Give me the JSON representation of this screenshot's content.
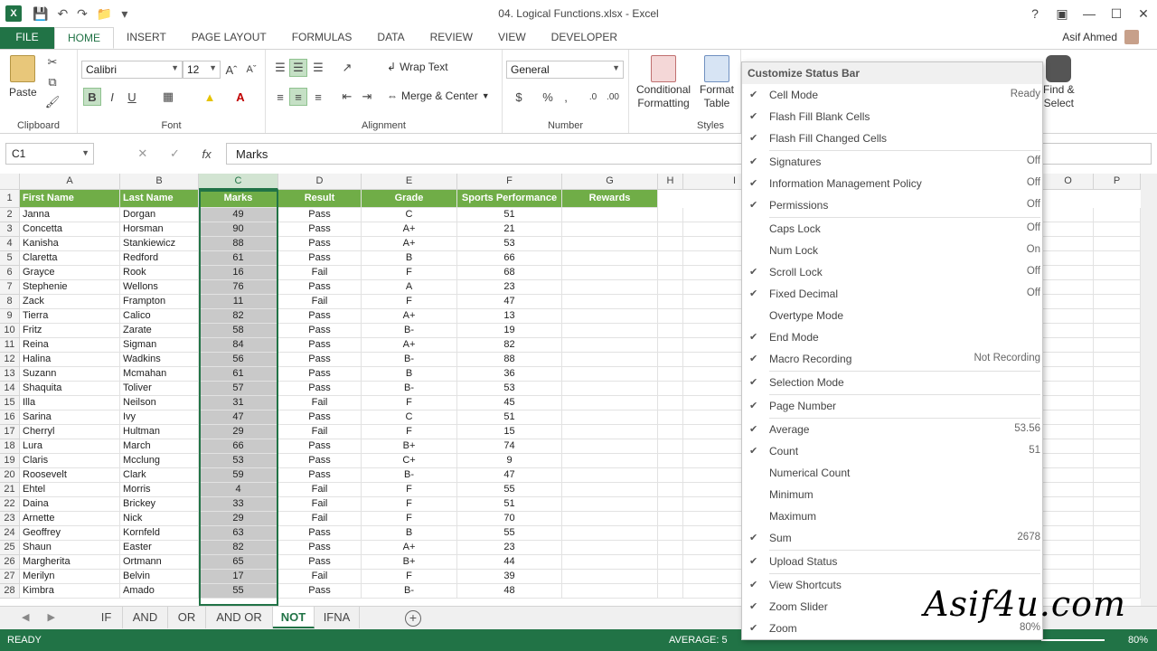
{
  "window": {
    "title": "04. Logical Functions.xlsx - Excel",
    "user_name": "Asif Ahmed"
  },
  "ribbon_tabs": [
    "FILE",
    "HOME",
    "INSERT",
    "PAGE LAYOUT",
    "FORMULAS",
    "DATA",
    "REVIEW",
    "VIEW",
    "DEVELOPER"
  ],
  "ribbon": {
    "clipboard": {
      "paste_label": "Paste",
      "group_label": "Clipboard"
    },
    "font": {
      "font_name": "Calibri",
      "font_size": "12",
      "group_label": "Font",
      "bold": "B",
      "italic": "I",
      "underline": "U"
    },
    "alignment": {
      "wrap_text": "Wrap Text",
      "merge_center": "Merge & Center",
      "group_label": "Alignment"
    },
    "number": {
      "format": "General",
      "group_label": "Number",
      "currency": "$",
      "percent": "%",
      "comma": ","
    },
    "styles": {
      "conditional_formatting_1": "Conditional",
      "conditional_formatting_2": "Formatting",
      "format_table_1": "Format",
      "format_table_2": "Table",
      "group_label": "Styles"
    },
    "editing": {
      "find_select_1": "Find &",
      "find_select_2": "Select"
    }
  },
  "formula_bar": {
    "name_box": "C1",
    "content": "Marks",
    "fx": "fx"
  },
  "columns": [
    "A",
    "B",
    "C",
    "D",
    "E",
    "F",
    "G",
    "H",
    "I",
    "O",
    "P"
  ],
  "headers": [
    "First Name",
    "Last Name",
    "Marks",
    "Result",
    "Grade",
    "Sports Performance",
    "Rewards"
  ],
  "rows": [
    [
      "Janna",
      "Dorgan",
      "49",
      "Pass",
      "C",
      "51"
    ],
    [
      "Concetta",
      "Horsman",
      "90",
      "Pass",
      "A+",
      "21"
    ],
    [
      "Kanisha",
      "Stankiewicz",
      "88",
      "Pass",
      "A+",
      "53"
    ],
    [
      "Claretta",
      "Redford",
      "61",
      "Pass",
      "B",
      "66"
    ],
    [
      "Grayce",
      "Rook",
      "16",
      "Fail",
      "F",
      "68"
    ],
    [
      "Stephenie",
      "Wellons",
      "76",
      "Pass",
      "A",
      "23"
    ],
    [
      "Zack",
      "Frampton",
      "11",
      "Fail",
      "F",
      "47"
    ],
    [
      "Tierra",
      "Calico",
      "82",
      "Pass",
      "A+",
      "13"
    ],
    [
      "Fritz",
      "Zarate",
      "58",
      "Pass",
      "B-",
      "19"
    ],
    [
      "Reina",
      "Sigman",
      "84",
      "Pass",
      "A+",
      "82"
    ],
    [
      "Halina",
      "Wadkins",
      "56",
      "Pass",
      "B-",
      "88"
    ],
    [
      "Suzann",
      "Mcmahan",
      "61",
      "Pass",
      "B",
      "36"
    ],
    [
      "Shaquita",
      "Toliver",
      "57",
      "Pass",
      "B-",
      "53"
    ],
    [
      "Illa",
      "Neilson",
      "31",
      "Fail",
      "F",
      "45"
    ],
    [
      "Sarina",
      "Ivy",
      "47",
      "Pass",
      "C",
      "51"
    ],
    [
      "Cherryl",
      "Hultman",
      "29",
      "Fail",
      "F",
      "15"
    ],
    [
      "Lura",
      "March",
      "66",
      "Pass",
      "B+",
      "74"
    ],
    [
      "Claris",
      "Mcclung",
      "53",
      "Pass",
      "C+",
      "9"
    ],
    [
      "Roosevelt",
      "Clark",
      "59",
      "Pass",
      "B-",
      "47"
    ],
    [
      "Ehtel",
      "Morris",
      "4",
      "Fail",
      "F",
      "55"
    ],
    [
      "Daina",
      "Brickey",
      "33",
      "Fail",
      "F",
      "51"
    ],
    [
      "Arnette",
      "Nick",
      "29",
      "Fail",
      "F",
      "70"
    ],
    [
      "Geoffrey",
      "Kornfeld",
      "63",
      "Pass",
      "B",
      "55"
    ],
    [
      "Shaun",
      "Easter",
      "82",
      "Pass",
      "A+",
      "23"
    ],
    [
      "Margherita",
      "Ortmann",
      "65",
      "Pass",
      "B+",
      "44"
    ],
    [
      "Merilyn",
      "Belvin",
      "17",
      "Fail",
      "F",
      "39"
    ],
    [
      "Kimbra",
      "Amado",
      "55",
      "Pass",
      "B-",
      "48"
    ]
  ],
  "sheet_tabs": [
    "IF",
    "AND",
    "OR",
    "AND OR",
    "NOT",
    "IFNA"
  ],
  "active_sheet": "NOT",
  "status_bar": {
    "mode": "READY",
    "average": "AVERAGE: 5",
    "zoom": "80%"
  },
  "context_menu": {
    "title": "Customize Status Bar",
    "items": [
      {
        "label": "Cell Mode",
        "checked": true,
        "value": "Ready"
      },
      {
        "label": "Flash Fill Blank Cells",
        "checked": true,
        "value": ""
      },
      {
        "label": "Flash Fill Changed Cells",
        "checked": true,
        "value": ""
      },
      {
        "label": "Signatures",
        "checked": true,
        "value": "Off"
      },
      {
        "label": "Information Management Policy",
        "checked": true,
        "value": "Off"
      },
      {
        "label": "Permissions",
        "checked": true,
        "value": "Off"
      },
      {
        "label": "Caps Lock",
        "checked": false,
        "value": "Off"
      },
      {
        "label": "Num Lock",
        "checked": false,
        "value": "On"
      },
      {
        "label": "Scroll Lock",
        "checked": true,
        "value": "Off"
      },
      {
        "label": "Fixed Decimal",
        "checked": true,
        "value": "Off"
      },
      {
        "label": "Overtype Mode",
        "checked": false,
        "value": ""
      },
      {
        "label": "End Mode",
        "checked": true,
        "value": ""
      },
      {
        "label": "Macro Recording",
        "checked": true,
        "value": "Not Recording"
      },
      {
        "label": "Selection Mode",
        "checked": true,
        "value": ""
      },
      {
        "label": "Page Number",
        "checked": true,
        "value": ""
      },
      {
        "label": "Average",
        "checked": true,
        "value": "53.56"
      },
      {
        "label": "Count",
        "checked": true,
        "value": "51"
      },
      {
        "label": "Numerical Count",
        "checked": false,
        "value": ""
      },
      {
        "label": "Minimum",
        "checked": false,
        "value": ""
      },
      {
        "label": "Maximum",
        "checked": false,
        "value": ""
      },
      {
        "label": "Sum",
        "checked": true,
        "value": "2678"
      },
      {
        "label": "Upload Status",
        "checked": true,
        "value": ""
      },
      {
        "label": "View Shortcuts",
        "checked": true,
        "value": ""
      },
      {
        "label": "Zoom Slider",
        "checked": true,
        "value": ""
      },
      {
        "label": "Zoom",
        "checked": true,
        "value": "80%"
      }
    ]
  },
  "watermark": "Asif4u.com",
  "colors": {
    "excel_green": "#217346",
    "header_fill": "#70ad47",
    "selected_fill": "#c9c9c9"
  }
}
